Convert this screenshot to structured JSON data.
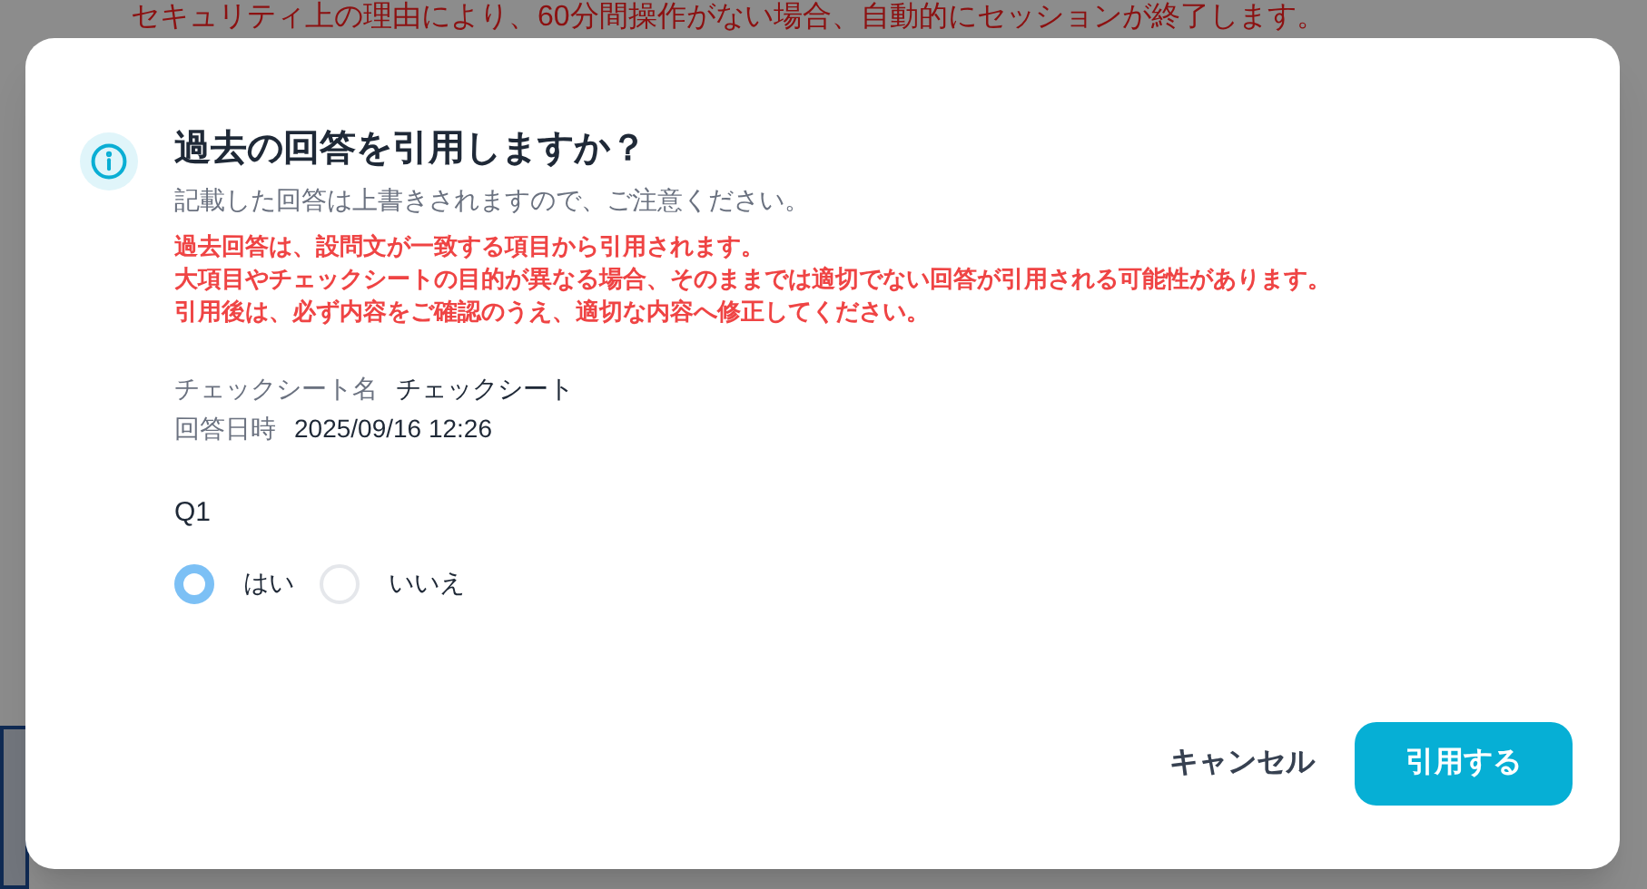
{
  "background_page": {
    "notice": "セキュリティ上の理由により、60分間操作がない場合、自動的にセッションが終了します。"
  },
  "dialog": {
    "title": "過去の回答を引用しますか？",
    "subtitle": "記載した回答は上書きされますので、ご注意ください。",
    "warnings": [
      "過去回答は、設問文が一致する項目から引用されます。",
      "大項目やチェックシートの目的が異なる場合、そのままでは適切でない回答が引用される可能性があります。",
      "引用後は、必ず内容をご確認のうえ、適切な内容へ修正してください。"
    ],
    "details": [
      {
        "label": "チェックシート名",
        "value": "チェックシート"
      },
      {
        "label": "回答日時",
        "value": "2025/09/16 12:26"
      }
    ],
    "question": {
      "label": "Q1",
      "options": [
        {
          "label": "はい",
          "selected": true
        },
        {
          "label": "いいえ",
          "selected": false
        }
      ]
    },
    "buttons": [
      {
        "kind": "secondary",
        "label": "キャンセル"
      },
      {
        "kind": "primary",
        "label": "引用する"
      }
    ]
  }
}
